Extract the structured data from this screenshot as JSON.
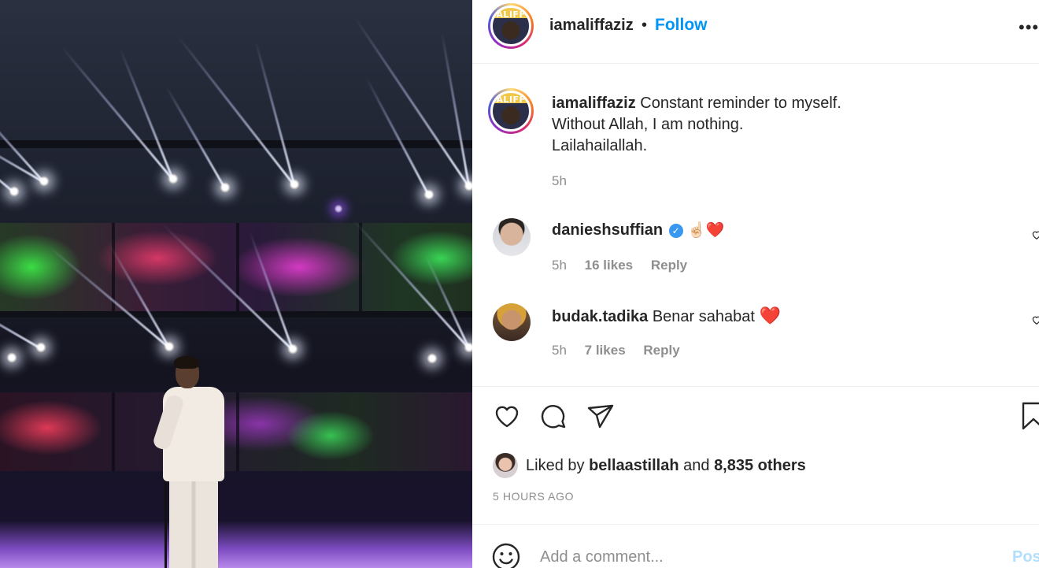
{
  "header": {
    "avatar_text": "ALIFF",
    "username": "iamaliffaziz",
    "separator": "•",
    "follow_label": "Follow",
    "more_label": "•••"
  },
  "caption": {
    "username": "iamaliffaziz",
    "lines": [
      "Constant reminder to myself.",
      "Without Allah, I am nothing.",
      "Lailahailallah."
    ],
    "time": "5h"
  },
  "comments": [
    {
      "username": "danieshsuffian",
      "verified": true,
      "text": "☝🏻❤️",
      "time": "5h",
      "likes": "16 likes",
      "reply": "Reply"
    },
    {
      "username": "budak.tadika",
      "verified": false,
      "text": "Benar sahabat",
      "emoji": "❤️",
      "time": "5h",
      "likes": "7 likes",
      "reply": "Reply"
    }
  ],
  "likes": {
    "prefix": "Liked by",
    "user": "bellaastillah",
    "conj": "and",
    "others": "8,835 others"
  },
  "post_time": "5 HOURS AGO",
  "comment_box": {
    "placeholder": "Add a comment...",
    "post_label": "Post"
  },
  "icons": {
    "like": "heart-icon",
    "comment": "comment-icon",
    "share": "paper-plane-icon",
    "save": "bookmark-icon",
    "emoji": "smiley-icon"
  },
  "colors": {
    "accent": "#0095f6",
    "text": "#262626",
    "muted": "#8e8e8e",
    "post_disabled": "#b2dffc"
  }
}
